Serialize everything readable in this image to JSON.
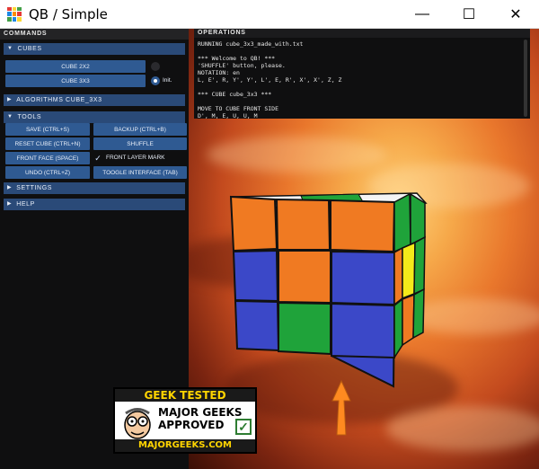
{
  "window": {
    "title": "QB / Simple",
    "minimize_glyph": "—",
    "maximize_glyph": "☐",
    "close_glyph": "✕"
  },
  "panels": {
    "commands_header": "COMMANDS",
    "operations_header": "OPERATIONS"
  },
  "sections": {
    "cubes": "CUBES",
    "algorithms": "ALGORITHMS CUBE_3X3",
    "tools": "TOOLS",
    "settings": "SETTINGS",
    "help": "HELP"
  },
  "cubes": {
    "cube_2x2": "CUBE 2X2",
    "cube_3x3": "CUBE 3X3",
    "init_label": "Init."
  },
  "tools": {
    "save": "SAVE (CTRL+S)",
    "backup": "BACKUP (CTRL+B)",
    "reset": "RESET CUBE (CTRL+N)",
    "shuffle": "SHUFFLE",
    "front_face": "FRONT FACE (SPACE)",
    "front_layer_mark": "FRONT LAYER MARK",
    "undo": "UNDO (CTRL+Z)",
    "toggle_interface": "TOOGLE INTERFACE (TAB)"
  },
  "operations": {
    "lines": [
      "RUNNING  cube_3x3_made_with.txt",
      "",
      "*** Welcome to QB! ***",
      "'SHUFFLE' button, please.",
      "NOTATION: en",
      "L, E', R, Y', Y', L', E, R', X', X', Z, Z",
      "",
      "*** CUBE cube_3x3 ***",
      "",
      "MOVE TO CUBE FRONT SIDE",
      "D', M, E, U, U, M"
    ]
  },
  "badge": {
    "top": "GEEK TESTED",
    "line1": "MAJOR GEEKS",
    "line2": "APPROVED",
    "bottom": "MAJORGEEKS.COM"
  },
  "colors": {
    "accent_button": "#2f5a92",
    "section_bg": "#2a4a78",
    "cube_orange": "#f07a22",
    "cube_blue": "#3b48c8",
    "cube_green": "#1fa33a",
    "cube_yellow": "#f3ea1a",
    "cube_white": "#f4f4f4",
    "arrow": "#ff8a20"
  }
}
